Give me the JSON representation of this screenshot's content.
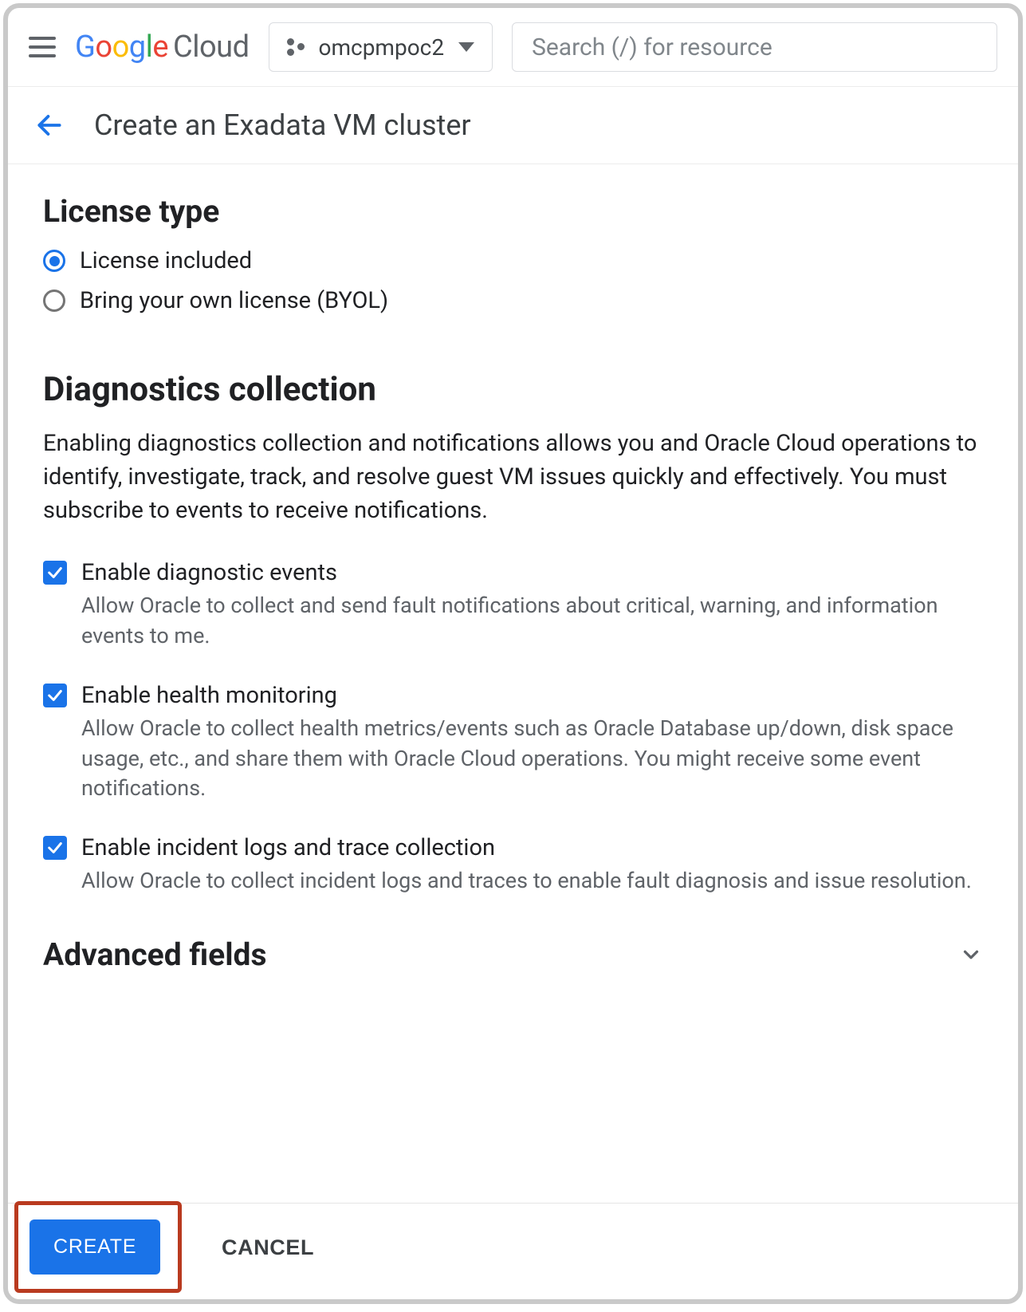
{
  "header": {
    "logo_google": "Google",
    "logo_cloud": "Cloud",
    "project_name": "omcpmpoc2",
    "search_placeholder": "Search (/) for resource"
  },
  "titlebar": {
    "page_title": "Create an Exadata VM cluster"
  },
  "license": {
    "heading": "License type",
    "options": [
      {
        "label": "License included",
        "selected": true
      },
      {
        "label": "Bring your own license (BYOL)",
        "selected": false
      }
    ]
  },
  "diagnostics": {
    "heading": "Diagnostics collection",
    "description": "Enabling diagnostics collection and notifications allows you and Oracle Cloud operations to identify, investigate, track, and resolve guest VM issues quickly and effectively. You must subscribe to events to receive notifications.",
    "items": [
      {
        "label": "Enable diagnostic events",
        "sub": "Allow Oracle to collect and send fault notifications about critical, warning, and information events to me.",
        "checked": true
      },
      {
        "label": "Enable health monitoring",
        "sub": "Allow Oracle to collect health metrics/events such as Oracle Database up/down, disk space usage, etc., and share them with Oracle Cloud operations. You might receive some event notifications.",
        "checked": true
      },
      {
        "label": "Enable incident logs and trace collection",
        "sub": "Allow Oracle to collect incident logs and traces to enable fault diagnosis and issue resolution.",
        "checked": true
      }
    ]
  },
  "advanced": {
    "heading": "Advanced fields"
  },
  "footer": {
    "create_label": "CREATE",
    "cancel_label": "CANCEL"
  }
}
